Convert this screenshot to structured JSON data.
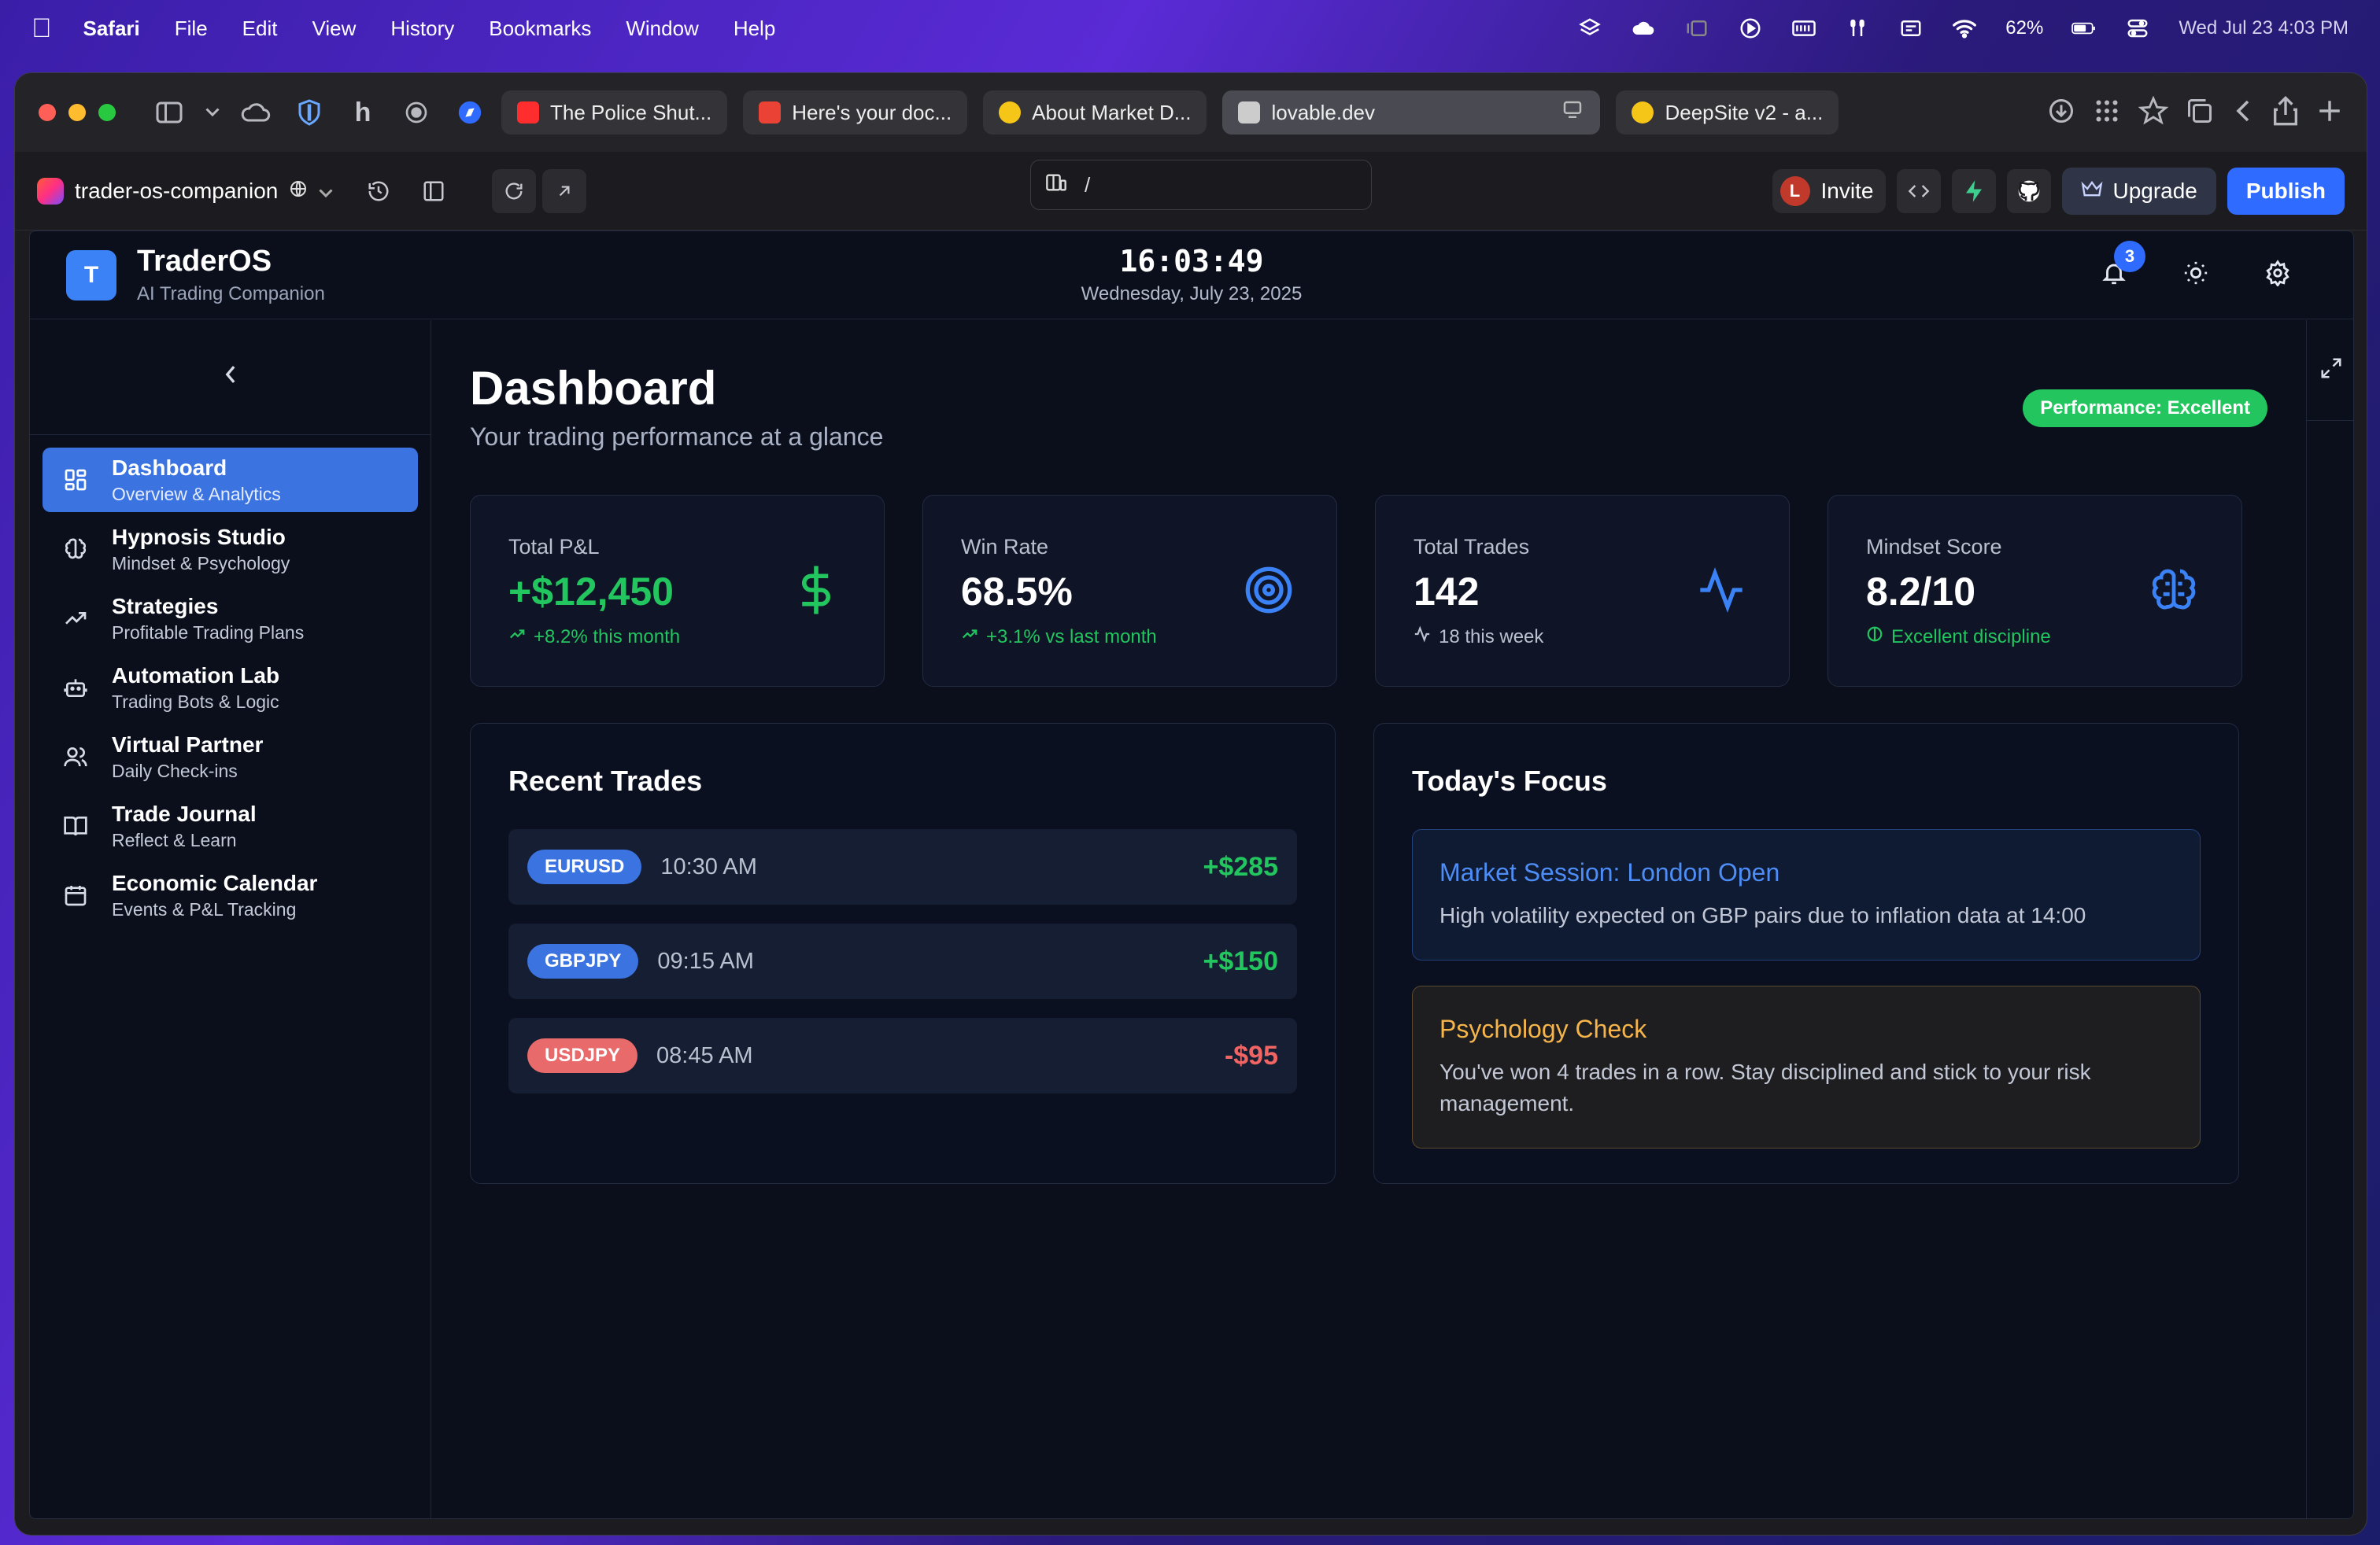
{
  "menubar": {
    "app": "Safari",
    "items": [
      "File",
      "Edit",
      "View",
      "History",
      "Bookmarks",
      "Window",
      "Help"
    ],
    "battery": "62%",
    "datetime": "Wed Jul 23  4:03 PM"
  },
  "browser": {
    "tabs": [
      {
        "label": "The Police Shut...",
        "favicon_color": "#ff2d2d"
      },
      {
        "label": "Here's your doc...",
        "favicon_color": "#ea4335"
      },
      {
        "label": "About Market D...",
        "favicon_color": "#f5c518"
      },
      {
        "label": "lovable.dev",
        "favicon_color": "#bbbbbb",
        "active": true
      },
      {
        "label": "DeepSite v2 - a...",
        "favicon_color": "#f5c518"
      }
    ]
  },
  "lovable": {
    "project_name": "trader-os-companion",
    "url_path": "/",
    "invite_label": "Invite",
    "avatar_letter": "L",
    "upgrade_label": "Upgrade",
    "publish_label": "Publish"
  },
  "app": {
    "brand_letter": "T",
    "brand_title": "TraderOS",
    "brand_subtitle": "AI Trading Companion",
    "clock_time": "16:03:49",
    "clock_date": "Wednesday, July 23, 2025",
    "notification_count": "3"
  },
  "sidebar": {
    "items": [
      {
        "title": "Dashboard",
        "subtitle": "Overview & Analytics",
        "icon": "grid-icon",
        "active": true
      },
      {
        "title": "Hypnosis Studio",
        "subtitle": "Mindset & Psychology",
        "icon": "brain-icon"
      },
      {
        "title": "Strategies",
        "subtitle": "Profitable Trading Plans",
        "icon": "trending-up-icon"
      },
      {
        "title": "Automation Lab",
        "subtitle": "Trading Bots & Logic",
        "icon": "bot-icon"
      },
      {
        "title": "Virtual Partner",
        "subtitle": "Daily Check-ins",
        "icon": "users-icon"
      },
      {
        "title": "Trade Journal",
        "subtitle": "Reflect & Learn",
        "icon": "book-icon"
      },
      {
        "title": "Economic Calendar",
        "subtitle": "Events & P&L Tracking",
        "icon": "calendar-icon"
      }
    ]
  },
  "dashboard": {
    "title": "Dashboard",
    "subtitle": "Your trading performance at a glance",
    "performance_badge": "Performance: Excellent",
    "cards": [
      {
        "label": "Total P&L",
        "value": "+$12,450",
        "foot": "+8.2% this month",
        "icon": "dollar-icon"
      },
      {
        "label": "Win Rate",
        "value": "68.5%",
        "foot": "+3.1% vs last month",
        "icon": "target-icon"
      },
      {
        "label": "Total Trades",
        "value": "142",
        "foot": "18 this week",
        "icon": "activity-icon"
      },
      {
        "label": "Mindset Score",
        "value": "8.2/10",
        "foot": "Excellent discipline",
        "icon": "brain-icon"
      }
    ],
    "recent_trades_title": "Recent Trades",
    "trades": [
      {
        "pair": "EURUSD",
        "time": "10:30 AM",
        "pnl": "+$285",
        "color": "#3b82f6",
        "pnl_color": "#22c55e"
      },
      {
        "pair": "GBPJPY",
        "time": "09:15 AM",
        "pnl": "+$150",
        "color": "#3b82f6",
        "pnl_color": "#22c55e"
      },
      {
        "pair": "USDJPY",
        "time": "08:45 AM",
        "pnl": "-$95",
        "color": "#ef6b6b",
        "pnl_color": "#f06464"
      }
    ],
    "focus_title": "Today's Focus",
    "focus_items": [
      {
        "title": "Market Session: London Open",
        "desc": "High volatility expected on GBP pairs due to inflation data at 14:00"
      },
      {
        "title": "Psychology Check",
        "desc": "You've won 4 trades in a row. Stay disciplined and stick to your risk management."
      }
    ]
  }
}
